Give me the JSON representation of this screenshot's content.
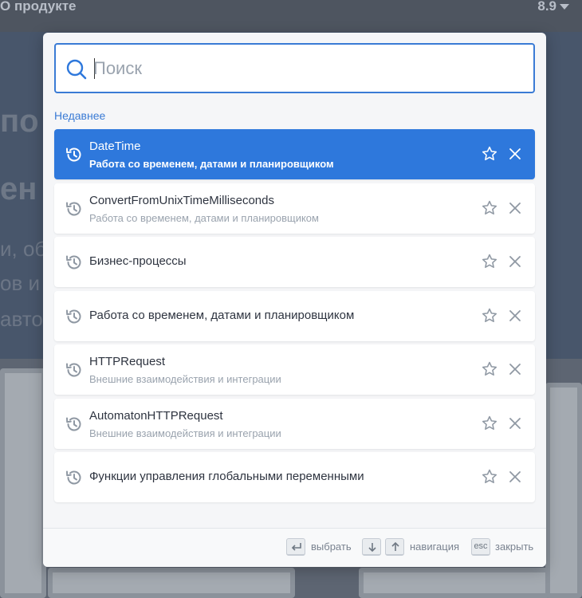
{
  "background": {
    "top_title": "О продукте",
    "version": "8.9",
    "hero_lines": [
      "по",
      "ен",
      "и, обо",
      "ов и",
      "авто"
    ]
  },
  "search": {
    "placeholder": "Поиск",
    "value": ""
  },
  "section_label": "Недавнее",
  "items": [
    {
      "title": "DateTime",
      "subtitle": "Работа со временем, датами и планировщиком",
      "active": true
    },
    {
      "title": "ConvertFromUnixTimeMilliseconds",
      "subtitle": "Работа со временем, датами и планировщиком",
      "active": false
    },
    {
      "title": "Бизнес-процессы",
      "subtitle": "",
      "active": false
    },
    {
      "title": "Работа со временем, датами и планировщиком",
      "subtitle": "",
      "active": false
    },
    {
      "title": "HTTPRequest",
      "subtitle": "Внешние взаимодействия и интеграции",
      "active": false
    },
    {
      "title": "AutomatonHTTPRequest",
      "subtitle": "Внешние взаимодействия и интеграции",
      "active": false
    },
    {
      "title": "Функции управления глобальными переменными",
      "subtitle": "",
      "active": false
    }
  ],
  "footer": {
    "select_label": "выбрать",
    "navigation_label": "навигация",
    "esc_key": "esc",
    "close_label": "закрыть"
  },
  "colors": {
    "accent": "#2e78dc",
    "text": "#2e3440",
    "muted": "#9aa3ae",
    "icon": "#8f98a3"
  },
  "icons": {
    "search": "search-icon",
    "history": "history-icon",
    "favorite": "star-icon",
    "remove": "close-icon"
  }
}
